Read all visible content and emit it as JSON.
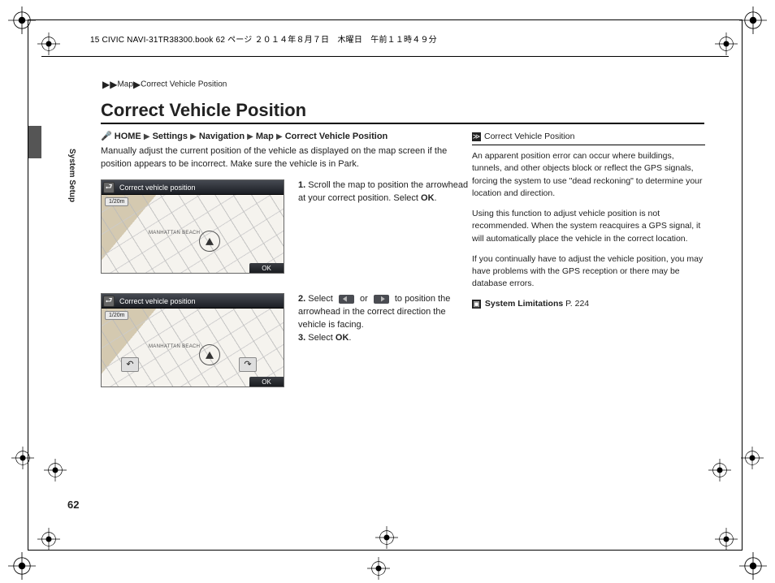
{
  "header": "15 CIVIC NAVI-31TR38300.book  62 ページ  ２０１４年８月７日　木曜日　午前１１時４９分",
  "sidebar_label": "System Setup",
  "page_number": "62",
  "breadcrumb": {
    "seg1": "Map",
    "seg2": "Correct Vehicle Position"
  },
  "title": "Correct Vehicle Position",
  "navpath": {
    "home": "HOME",
    "p1": "Settings",
    "p2": "Navigation",
    "p3": "Map",
    "p4": "Correct Vehicle Position"
  },
  "intro": "Manually adjust the current position of the vehicle as displayed on the map screen if the position appears to be incorrect. Make sure the vehicle is in Park.",
  "screenshot": {
    "title": "Correct vehicle position",
    "scale": "1/20m",
    "ok": "OK",
    "loc": "MANHATTAN BEACH"
  },
  "steps": {
    "s1": "Scroll the map to position the arrowhead at your correct position. Select ",
    "s1_ok": "OK",
    "s2a": "Select ",
    "s2b": " or ",
    "s2c": " to position the arrowhead in the correct direction the vehicle is facing.",
    "s3a": "Select ",
    "s3b": "OK"
  },
  "sidebox": {
    "head": "Correct Vehicle Position",
    "p1": "An apparent position error can occur where buildings, tunnels, and other objects block or reflect the GPS signals, forcing the system to use \"dead reckoning\" to determine your location and direction.",
    "p2": "Using this function to adjust vehicle position is not recommended. When the system reacquires a GPS signal, it will automatically place the vehicle in the correct location.",
    "p3": "If you continually have to adjust the vehicle position, you may have problems with the GPS reception or there may be database errors.",
    "link_label": "System Limitations",
    "link_page": "P. 224"
  }
}
